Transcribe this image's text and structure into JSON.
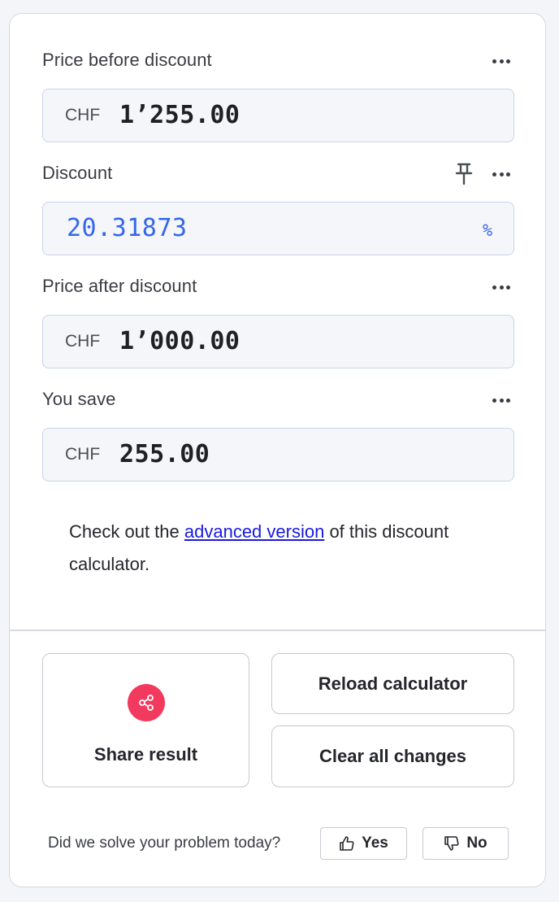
{
  "fields": [
    {
      "label": "Price before discount",
      "currency": "CHF",
      "value": "1’255.00"
    },
    {
      "label": "Discount",
      "value": "20.31873",
      "unit": "%"
    },
    {
      "label": "Price after discount",
      "currency": "CHF",
      "value": "1’000.00"
    },
    {
      "label": "You save",
      "currency": "CHF",
      "value": "255.00"
    }
  ],
  "note": {
    "prefix": "Check out the ",
    "link": "advanced version",
    "suffix": " of this discount calculator."
  },
  "actions": {
    "share": "Share result",
    "reload": "Reload calculator",
    "clear": "Clear all changes"
  },
  "feedback": {
    "question": "Did we solve your problem today?",
    "yes": "Yes",
    "no": "No"
  },
  "colors": {
    "accent_blue": "#3466ec",
    "share_red": "#f23a5f",
    "link": "#1a1ae0"
  },
  "icons": [
    "more-options-icon",
    "pin-icon",
    "share-icon",
    "thumbs-up-icon",
    "thumbs-down-icon"
  ]
}
